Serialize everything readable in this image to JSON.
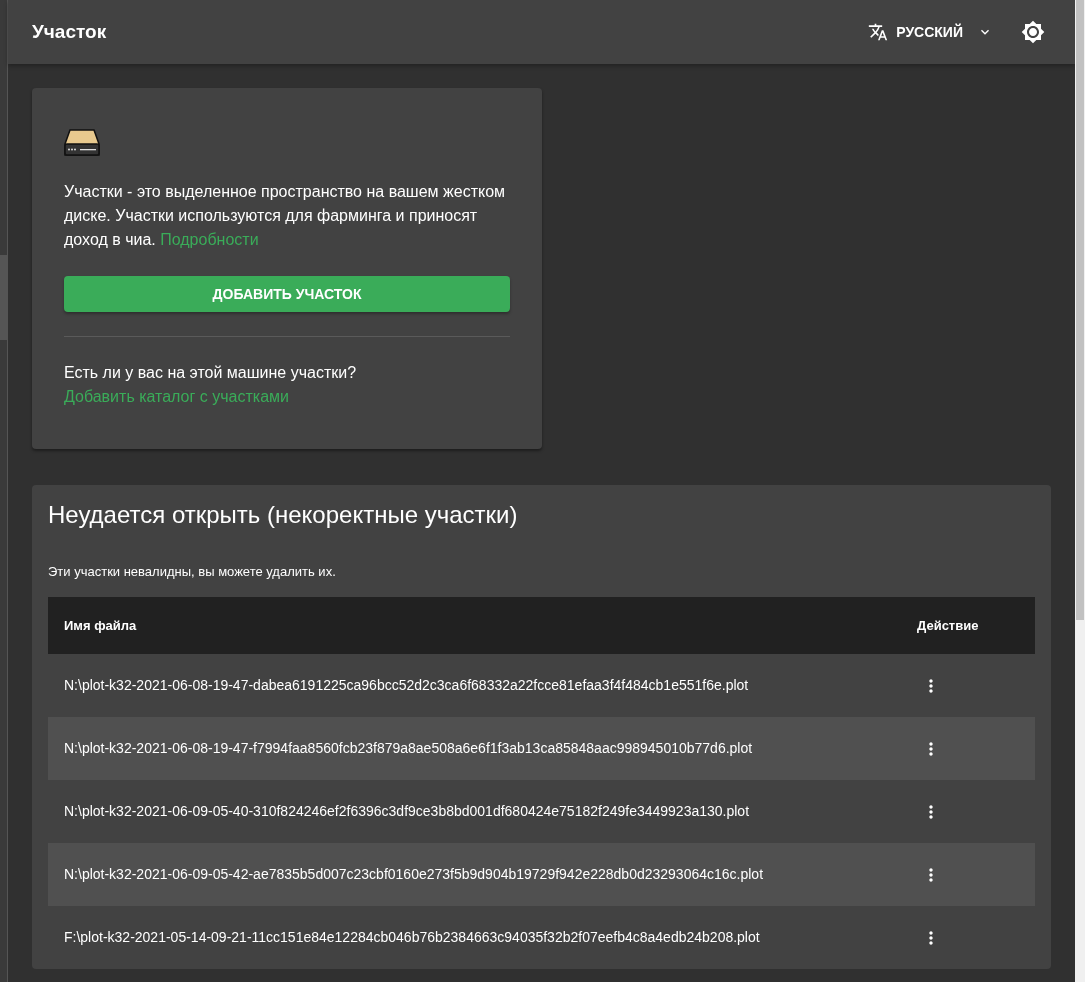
{
  "header": {
    "title": "Участок",
    "language": "РУССКИЙ"
  },
  "intro_card": {
    "description": "Участки - это выделенное пространство на вашем жестком диске. Участки используются для фарминга и приносят доход в чиа.",
    "description_link": "Подробности",
    "add_button": "ДОБАВИТЬ УЧАСТОК",
    "question": "Есть ли у вас на этой машине участки?",
    "question_link": "Добавить каталог с участками"
  },
  "invalid_panel": {
    "title": "Неудается открыть (некоректные участки)",
    "subtitle": "Эти участки невалидны, вы можете удалить их.",
    "table": {
      "columns": [
        "Имя файла",
        "Действие"
      ],
      "rows": [
        {
          "filename": "N:\\plot-k32-2021-06-08-19-47-dabea6191225ca96bcc52d2c3ca6f68332a22fcce81efaa3f4f484cb1e551f6e.plot"
        },
        {
          "filename": "N:\\plot-k32-2021-06-08-19-47-f7994faa8560fcb23f879a8ae508a6e6f1f3ab13ca85848aac998945010b77d6.plot"
        },
        {
          "filename": "N:\\plot-k32-2021-06-09-05-40-310f824246ef2f6396c3df9ce3b8bd001df680424e75182f249fe3449923a130.plot"
        },
        {
          "filename": "N:\\plot-k32-2021-06-09-05-42-ae7835b5d007c23cbf0160e273f5b9d904b19729f942e228db0d23293064c16c.plot"
        },
        {
          "filename": "F:\\plot-k32-2021-05-14-09-21-11cc151e84e12284cb046b76b2384663c94035f32b2f07eefb4c8a4edb24b208.plot"
        }
      ]
    }
  }
}
